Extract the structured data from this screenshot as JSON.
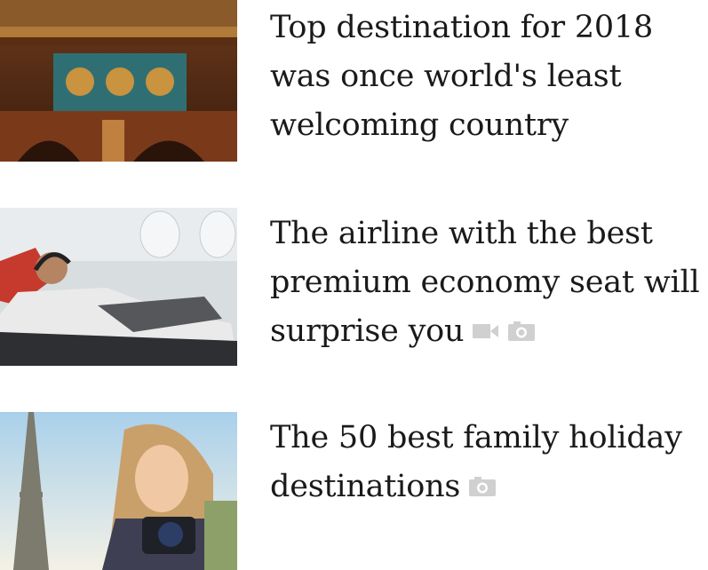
{
  "articles": [
    {
      "headline": "Top destination for 2018 was once world's least welcoming country",
      "image_alt": "Painted church interior with religious figures",
      "icons": []
    },
    {
      "headline": "The airline with the best premium economy seat will surprise you",
      "image_alt": "Man reclining in an airline seat wearing headphones",
      "icons": [
        "video-icon",
        "camera-icon"
      ]
    },
    {
      "headline": "The 50 best family holiday destinations",
      "image_alt": "Girl with a camera in front of the Eiffel Tower",
      "icons": [
        "camera-icon"
      ]
    }
  ],
  "colors": {
    "headline": "#1a1a1a",
    "icon": "#d0d0d0"
  }
}
